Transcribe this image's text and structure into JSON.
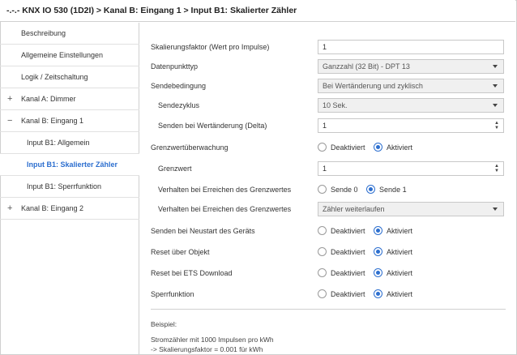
{
  "title": "-.-.- KNX IO 530 (1D2I) > Kanal B: Eingang 1 > Input B1: Skalierter Zähler",
  "sidebar": {
    "items": [
      {
        "label": "Beschreibung",
        "prefix": ""
      },
      {
        "label": "Allgemeine Einstellungen",
        "prefix": ""
      },
      {
        "label": "Logik / Zeitschaltung",
        "prefix": ""
      },
      {
        "label": "Kanal A: Dimmer",
        "prefix": "+"
      },
      {
        "label": "Kanal B: Eingang 1",
        "prefix": "−"
      },
      {
        "label": "Input B1: Allgemein",
        "prefix": ""
      },
      {
        "label": "Input B1: Skalierter Zähler",
        "prefix": ""
      },
      {
        "label": "Input B1: Sperrfunktion",
        "prefix": ""
      },
      {
        "label": "Kanal B: Eingang 2",
        "prefix": "+"
      }
    ],
    "active_index": 6
  },
  "params": {
    "scale_factor": {
      "label": "Skalierungsfaktor (Wert pro Impulse)",
      "value": "1"
    },
    "dpt": {
      "label": "Datenpunkttyp",
      "value": "Ganzzahl (32 Bit) - DPT 13"
    },
    "send_condition": {
      "label": "Sendebedingung",
      "value": "Bei Wertänderung und zyklisch"
    },
    "send_cycle": {
      "label": "Sendezyklus",
      "value": "10 Sek."
    },
    "send_delta": {
      "label": "Senden bei Wertänderung (Delta)",
      "value": "1"
    },
    "limit_monitor": {
      "label": "Grenzwertüberwachung",
      "opt1": "Deaktiviert",
      "opt2": "Aktiviert"
    },
    "limit_value": {
      "label": "Grenzwert",
      "value": "1"
    },
    "limit_behavior1": {
      "label": "Verhalten bei Erreichen des Grenzwertes",
      "opt1": "Sende 0",
      "opt2": "Sende 1"
    },
    "limit_behavior2": {
      "label": "Verhalten bei Erreichen des Grenzwertes",
      "value": "Zähler weiterlaufen"
    },
    "send_restart": {
      "label": "Senden bei Neustart des Geräts",
      "opt1": "Deaktiviert",
      "opt2": "Aktiviert"
    },
    "reset_object": {
      "label": "Reset über Objekt",
      "opt1": "Deaktiviert",
      "opt2": "Aktiviert"
    },
    "reset_ets": {
      "label": "Reset bei ETS Download",
      "opt1": "Deaktiviert",
      "opt2": "Aktiviert"
    },
    "lock_function": {
      "label": "Sperrfunktion",
      "opt1": "Deaktiviert",
      "opt2": "Aktiviert"
    }
  },
  "note": {
    "heading": "Beispiel:",
    "line1": "Stromzähler mit 1000 Impulsen pro kWh",
    "line2": "-> Skalierungsfaktor = 0.001 für kWh"
  },
  "colors": {
    "accent": "#2d6fcf",
    "border": "#d0d0d0"
  }
}
